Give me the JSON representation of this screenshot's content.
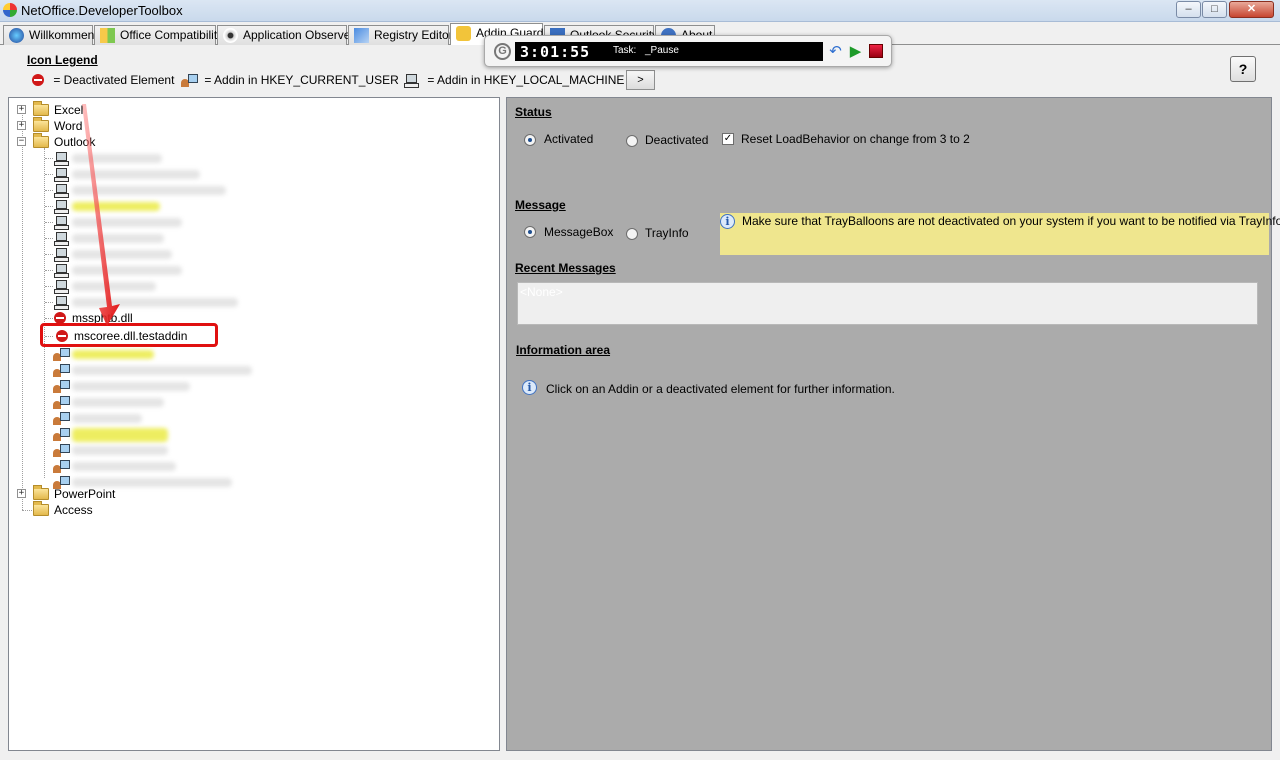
{
  "window": {
    "title": "NetOffice.DeveloperToolbox"
  },
  "tabs": [
    {
      "label": "Willkommen"
    },
    {
      "label": "Office Compatibility"
    },
    {
      "label": "Application Observer"
    },
    {
      "label": "Registry Editor"
    },
    {
      "label": "Addin Guard"
    },
    {
      "label": "Outlook Security"
    },
    {
      "label": "About"
    }
  ],
  "legend": {
    "title": "Icon Legend",
    "deactivated": "= Deactivated Element",
    "current_user": "= Addin in HKEY_CURRENT_USER",
    "local_machine": "= Addin in HKEY_LOCAL_MACHINE",
    "more_button": ">"
  },
  "help_button": "?",
  "timer": {
    "clock": "3:01:55",
    "task_label": "Task:",
    "task_value": "_Pause"
  },
  "tree": {
    "excel": "Excel",
    "word": "Word",
    "outlook": "Outlook",
    "mssphtb": "mssphtb.dll",
    "testaddin": "mscoree.dll.testaddin",
    "powerpoint": "PowerPoint",
    "access": "Access"
  },
  "status": {
    "title": "Status",
    "activated": "Activated",
    "deactivated": "Deactivated",
    "reset_label": "Reset LoadBehavior on change from 3 to 2"
  },
  "message": {
    "title": "Message",
    "messagebox": "MessageBox",
    "trayinfo": "TrayInfo",
    "info_text": "Make sure that TrayBalloons are not deactivated on your system if you want to be notified via TrayInfo."
  },
  "recent": {
    "title": "Recent Messages",
    "value": "<None>"
  },
  "information": {
    "title": "Information area",
    "text": "Click on an Addin or a deactivated element for further information."
  },
  "colors": {
    "highlight_red": "#e01010",
    "info_yellow": "#efe68e",
    "panel_gray": "#ababab"
  }
}
